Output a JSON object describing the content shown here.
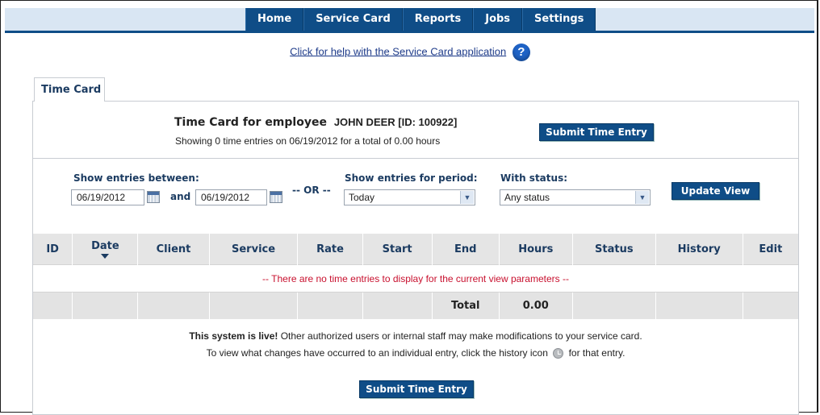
{
  "nav": {
    "items": [
      "Home",
      "Service Card",
      "Reports",
      "Jobs",
      "Settings"
    ]
  },
  "help": {
    "link_text": "Click for help with the Service Card application",
    "icon": "?"
  },
  "tab": {
    "label": "Time Card"
  },
  "header": {
    "title_prefix": "Time Card for employee",
    "employee": "JOHN DEER [ID: 100922]",
    "summary": "Showing 0 time entries on 06/19/2012 for a total of 0.00 hours",
    "submit_label": "Submit Time Entry"
  },
  "filters": {
    "between_label": "Show entries between:",
    "start_date": "06/19/2012",
    "and_label": "and",
    "end_date": "06/19/2012",
    "or_label": "-- OR --",
    "period_label": "Show entries for period:",
    "period_value": "Today",
    "status_label": "With status:",
    "status_value": "Any status",
    "update_label": "Update View"
  },
  "table": {
    "columns": [
      "ID",
      "Date",
      "Client",
      "Service",
      "Rate",
      "Start",
      "End",
      "Hours",
      "Status",
      "History",
      "Edit"
    ],
    "empty_message": "-- There are no time entries to display for the current view parameters --",
    "total_label": "Total",
    "total_hours": "0.00"
  },
  "footer": {
    "live_bold": "This system is live!",
    "live_rest": " Other authorized users or internal staff may make modifications to your service card.",
    "history_before": "To view what changes have occurred to an individual entry, click the history icon",
    "history_after": "for that entry.",
    "submit_label": "Submit Time Entry"
  }
}
